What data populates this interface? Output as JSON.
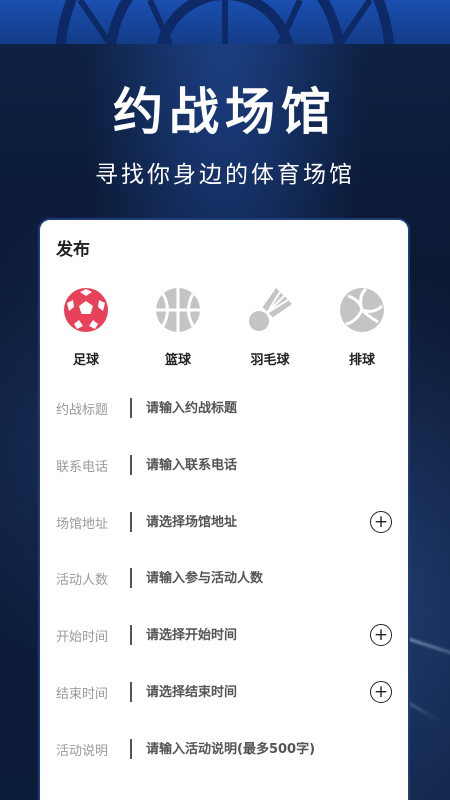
{
  "hero": {
    "title": "约战场馆",
    "subtitle": "寻找你身边的体育场馆"
  },
  "card": {
    "title": "发布",
    "sports": [
      {
        "label": "足球",
        "icon": "soccer-ball-icon",
        "color": "#e8425a"
      },
      {
        "label": "篮球",
        "icon": "basketball-icon",
        "color": "#c4c4c4"
      },
      {
        "label": "羽毛球",
        "icon": "shuttlecock-icon",
        "color": "#c4c4c4"
      },
      {
        "label": "排球",
        "icon": "volleyball-icon",
        "color": "#c4c4c4"
      }
    ],
    "fields": [
      {
        "label": "约战标题",
        "placeholder": "请输入约战标题",
        "has_plus": false
      },
      {
        "label": "联系电话",
        "placeholder": "请输入联系电话",
        "has_plus": false
      },
      {
        "label": "场馆地址",
        "placeholder": "请选择场馆地址",
        "has_plus": true
      },
      {
        "label": "活动人数",
        "placeholder": "请输入参与活动人数",
        "has_plus": false
      },
      {
        "label": "开始时间",
        "placeholder": "请选择开始时间",
        "has_plus": true
      },
      {
        "label": "结束时间",
        "placeholder": "请选择结束时间",
        "has_plus": true
      },
      {
        "label": "活动说明",
        "placeholder": "请输入活动说明(最多500字)",
        "has_plus": false
      }
    ],
    "plus_symbol": "+"
  }
}
